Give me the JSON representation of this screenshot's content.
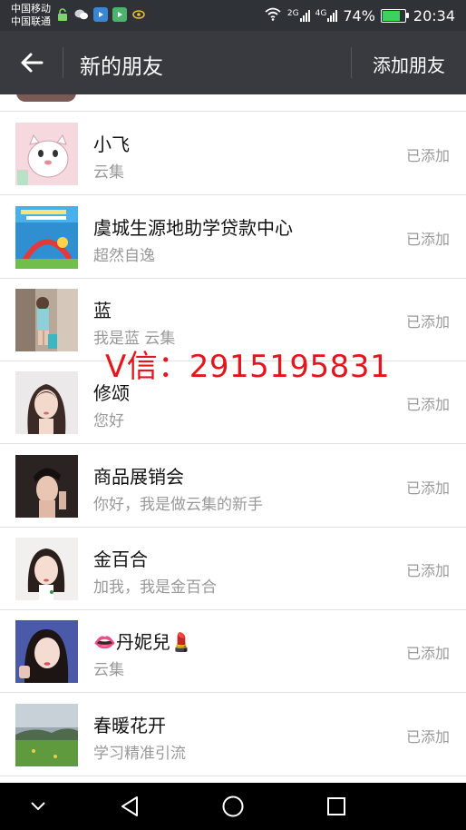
{
  "status_bar": {
    "carrier1": "中国移动",
    "carrier2": "中国联通",
    "net1": "2G",
    "net2": "4G",
    "battery": "74%",
    "battery_level": 0.74,
    "time": "20:34"
  },
  "header": {
    "title": "新的朋友",
    "action_label": "添加朋友"
  },
  "friends": [
    {
      "name": "小飞",
      "message": "云集",
      "status": "已添加",
      "avatar": "cartoon-cat"
    },
    {
      "name": "虞城生源地助学贷款中心",
      "message": "超然自逸",
      "status": "已添加",
      "avatar": "loan-banner"
    },
    {
      "name": "蓝",
      "message": "我是蓝  云集",
      "status": "已添加",
      "avatar": "girl-shop"
    },
    {
      "name": "修颂",
      "message": "您好",
      "status": "已添加",
      "avatar": "woman-portrait"
    },
    {
      "name": "商品展销会",
      "message": "你好，我是做云集的新手",
      "status": "已添加",
      "avatar": "man-portrait"
    },
    {
      "name": "金百合",
      "message": "加我，我是金百合",
      "status": "已添加",
      "avatar": "girl-portrait"
    },
    {
      "name": "👄丹妮兒💄",
      "message": "云集",
      "status": "已添加",
      "avatar": "selfie-portrait"
    },
    {
      "name": "春暖花开",
      "message": "学习精准引流",
      "status": "已添加",
      "avatar": "landscape"
    }
  ],
  "watermark": "V信：2915195831",
  "colors": {
    "header_bg": "#393a3f",
    "status_bg": "#2f3236",
    "watermark": "#e4161d",
    "secondary_text": "#999999"
  }
}
